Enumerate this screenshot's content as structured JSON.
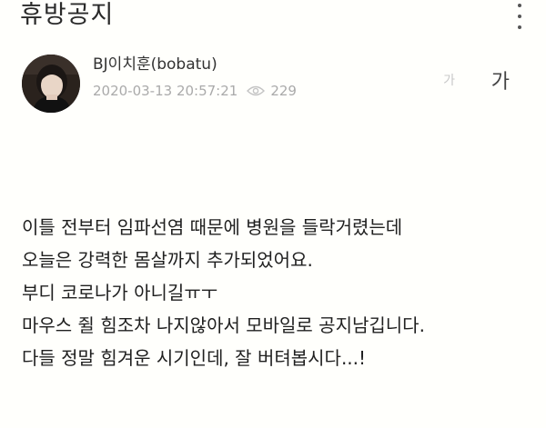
{
  "header": {
    "title": "휴방공지"
  },
  "author": {
    "name": "BJ이치훈(bobatu)",
    "date": "2020-03-13 20:57:21",
    "views": "229"
  },
  "font_size": {
    "small_label": "가",
    "large_label": "가"
  },
  "content": {
    "lines": [
      "이틀 전부터 임파선염 때문에 병원을 들락거렸는데",
      "오늘은 강력한 몸살까지 추가되었어요.",
      "부디 코로나가 아니길ㅠㅜ",
      "마우스 쥘 힘조차 나지않아서 모바일로 공지남깁니다.",
      "다들 정말 힘겨운 시기인데, 잘 버텨봅시다...!"
    ]
  }
}
